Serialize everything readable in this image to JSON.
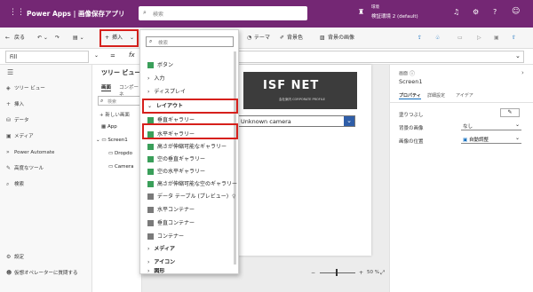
{
  "header": {
    "app_title": "Power Apps | 画像保存アプリ",
    "search_placeholder": "検索",
    "env_label": "環境",
    "env_name": "検証環境 2 (default)"
  },
  "toolbar": {
    "back": "戻る",
    "insert": "挿入",
    "theme": "テーマ",
    "bg_color": "背景色",
    "bg_image": "背景の画像"
  },
  "formula": {
    "property": "Fill",
    "fx": "fx"
  },
  "leftnav": {
    "items": [
      {
        "label": "ツリー ビュー",
        "icon": "layers-icon"
      },
      {
        "label": "挿入",
        "icon": "plus-icon"
      },
      {
        "label": "データ",
        "icon": "database-icon"
      },
      {
        "label": "メディア",
        "icon": "media-icon"
      },
      {
        "label": "Power Automate",
        "icon": "flow-icon"
      },
      {
        "label": "高度なツール",
        "icon": "tools-icon"
      },
      {
        "label": "検索",
        "icon": "search-icon"
      }
    ],
    "settings": "設定",
    "virtual_agent": "仮想オペレーターに質問する"
  },
  "tree": {
    "title": "ツリー ビュー",
    "tabs": [
      "画面",
      "コンポーネ"
    ],
    "search": "検索",
    "new_screen": "新しい画面",
    "items": [
      "App",
      "Screen1",
      "Dropdo",
      "Camera"
    ]
  },
  "insert_menu": {
    "search_placeholder": "検索",
    "items": [
      {
        "label": "ボタン",
        "type": "item"
      },
      {
        "label": "入力",
        "type": "group"
      },
      {
        "label": "ディスプレイ",
        "type": "group"
      },
      {
        "label": "レイアウト",
        "type": "group-open"
      },
      {
        "label": "垂直ギャラリー",
        "type": "item"
      },
      {
        "label": "水平ギャラリー",
        "type": "item"
      },
      {
        "label": "高さが伸縮可能なギャラリー",
        "type": "item"
      },
      {
        "label": "空の垂直ギャラリー",
        "type": "item"
      },
      {
        "label": "空の水平ギャラリー",
        "type": "item"
      },
      {
        "label": "高さが伸縮可能な空のギャラリー",
        "type": "item"
      },
      {
        "label": "データ テーブル (プレビュー)",
        "type": "item"
      },
      {
        "label": "水平コンテナー",
        "type": "item"
      },
      {
        "label": "垂直コンテナー",
        "type": "item"
      },
      {
        "label": "コンテナー",
        "type": "item"
      },
      {
        "label": "メディア",
        "type": "group"
      },
      {
        "label": "アイコン",
        "type": "group"
      },
      {
        "label": "図形",
        "type": "group"
      }
    ]
  },
  "canvas": {
    "logo": "ISF NET",
    "logo_sub": "会社案内 CORPORATE PROFILE",
    "camera_select": "Unknown camera",
    "zoom": "50 %"
  },
  "right": {
    "section": "画面",
    "name": "Screen1",
    "tabs": [
      "プロパティ",
      "詳細設定",
      "アイデア"
    ],
    "rows": [
      {
        "label": "塗りつぶし",
        "value": ""
      },
      {
        "label": "背景の画像",
        "value": "なし"
      },
      {
        "label": "画像の位置",
        "value": "自動調整"
      }
    ]
  },
  "colors": {
    "header": "#742774",
    "highlight": "#d6201c",
    "accent": "#0f6cbd"
  }
}
